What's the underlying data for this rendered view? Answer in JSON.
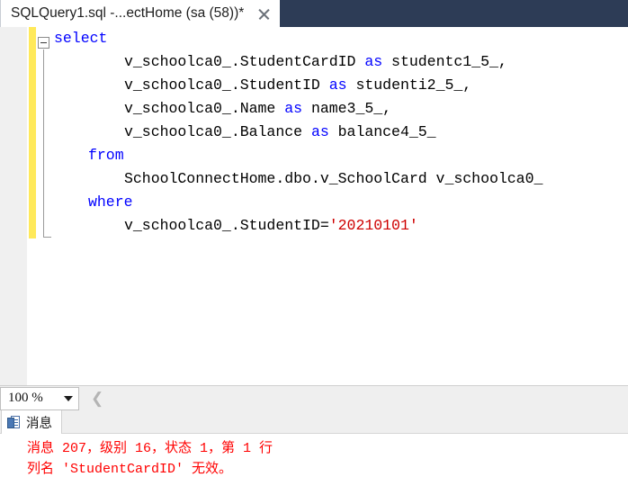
{
  "window": {
    "tab_title": "SQLQuery1.sql -...ectHome (sa (58))*",
    "close_icon": "close-icon",
    "header_color": "#2d3c56"
  },
  "editor": {
    "outline_state": "expanded",
    "change_bar_color": "#ffe95a",
    "lines": [
      {
        "indent": 0,
        "tokens": [
          {
            "t": "select",
            "k": "kw"
          }
        ]
      },
      {
        "indent": 3,
        "tokens": [
          {
            "t": "v_schoolca0_.StudentCardID ",
            "k": "plain"
          },
          {
            "t": "as",
            "k": "kw"
          },
          {
            "t": " studentc1_5_,",
            "k": "plain"
          }
        ]
      },
      {
        "indent": 3,
        "tokens": [
          {
            "t": "v_schoolca0_.StudentID ",
            "k": "plain"
          },
          {
            "t": "as",
            "k": "kw"
          },
          {
            "t": " studenti2_5_,",
            "k": "plain"
          }
        ]
      },
      {
        "indent": 3,
        "tokens": [
          {
            "t": "v_schoolca0_.Name ",
            "k": "plain"
          },
          {
            "t": "as",
            "k": "kw"
          },
          {
            "t": " name3_5_,",
            "k": "plain"
          }
        ]
      },
      {
        "indent": 3,
        "tokens": [
          {
            "t": "v_schoolca0_.Balance ",
            "k": "plain"
          },
          {
            "t": "as",
            "k": "kw"
          },
          {
            "t": " balance4_5_",
            "k": "plain"
          }
        ]
      },
      {
        "indent": 1,
        "tokens": [
          {
            "t": "from",
            "k": "kw"
          }
        ]
      },
      {
        "indent": 3,
        "tokens": [
          {
            "t": "SchoolConnectHome.dbo.v_SchoolCard v_schoolca0_",
            "k": "plain"
          }
        ]
      },
      {
        "indent": 1,
        "tokens": [
          {
            "t": "where",
            "k": "kw"
          }
        ]
      },
      {
        "indent": 3,
        "tokens": [
          {
            "t": "v_schoolca0_.StudentID=",
            "k": "plain"
          },
          {
            "t": "'20210101'",
            "k": "str"
          }
        ]
      }
    ],
    "colors": {
      "keyword": "#0000ff",
      "string": "#ce0000",
      "plain": "#000000"
    }
  },
  "status_strip": {
    "zoom_value": "100 %",
    "caret_icon": "chevron-down-icon",
    "scroll_left_icon": "chevron-left-icon"
  },
  "results": {
    "tab_label": "消息",
    "tab_icon": "messages-icon",
    "messages": [
      "消息 207，级别 16，状态 1，第 1 行",
      "列名 'StudentCardID' 无效。"
    ],
    "message_color": "#ff0000"
  }
}
